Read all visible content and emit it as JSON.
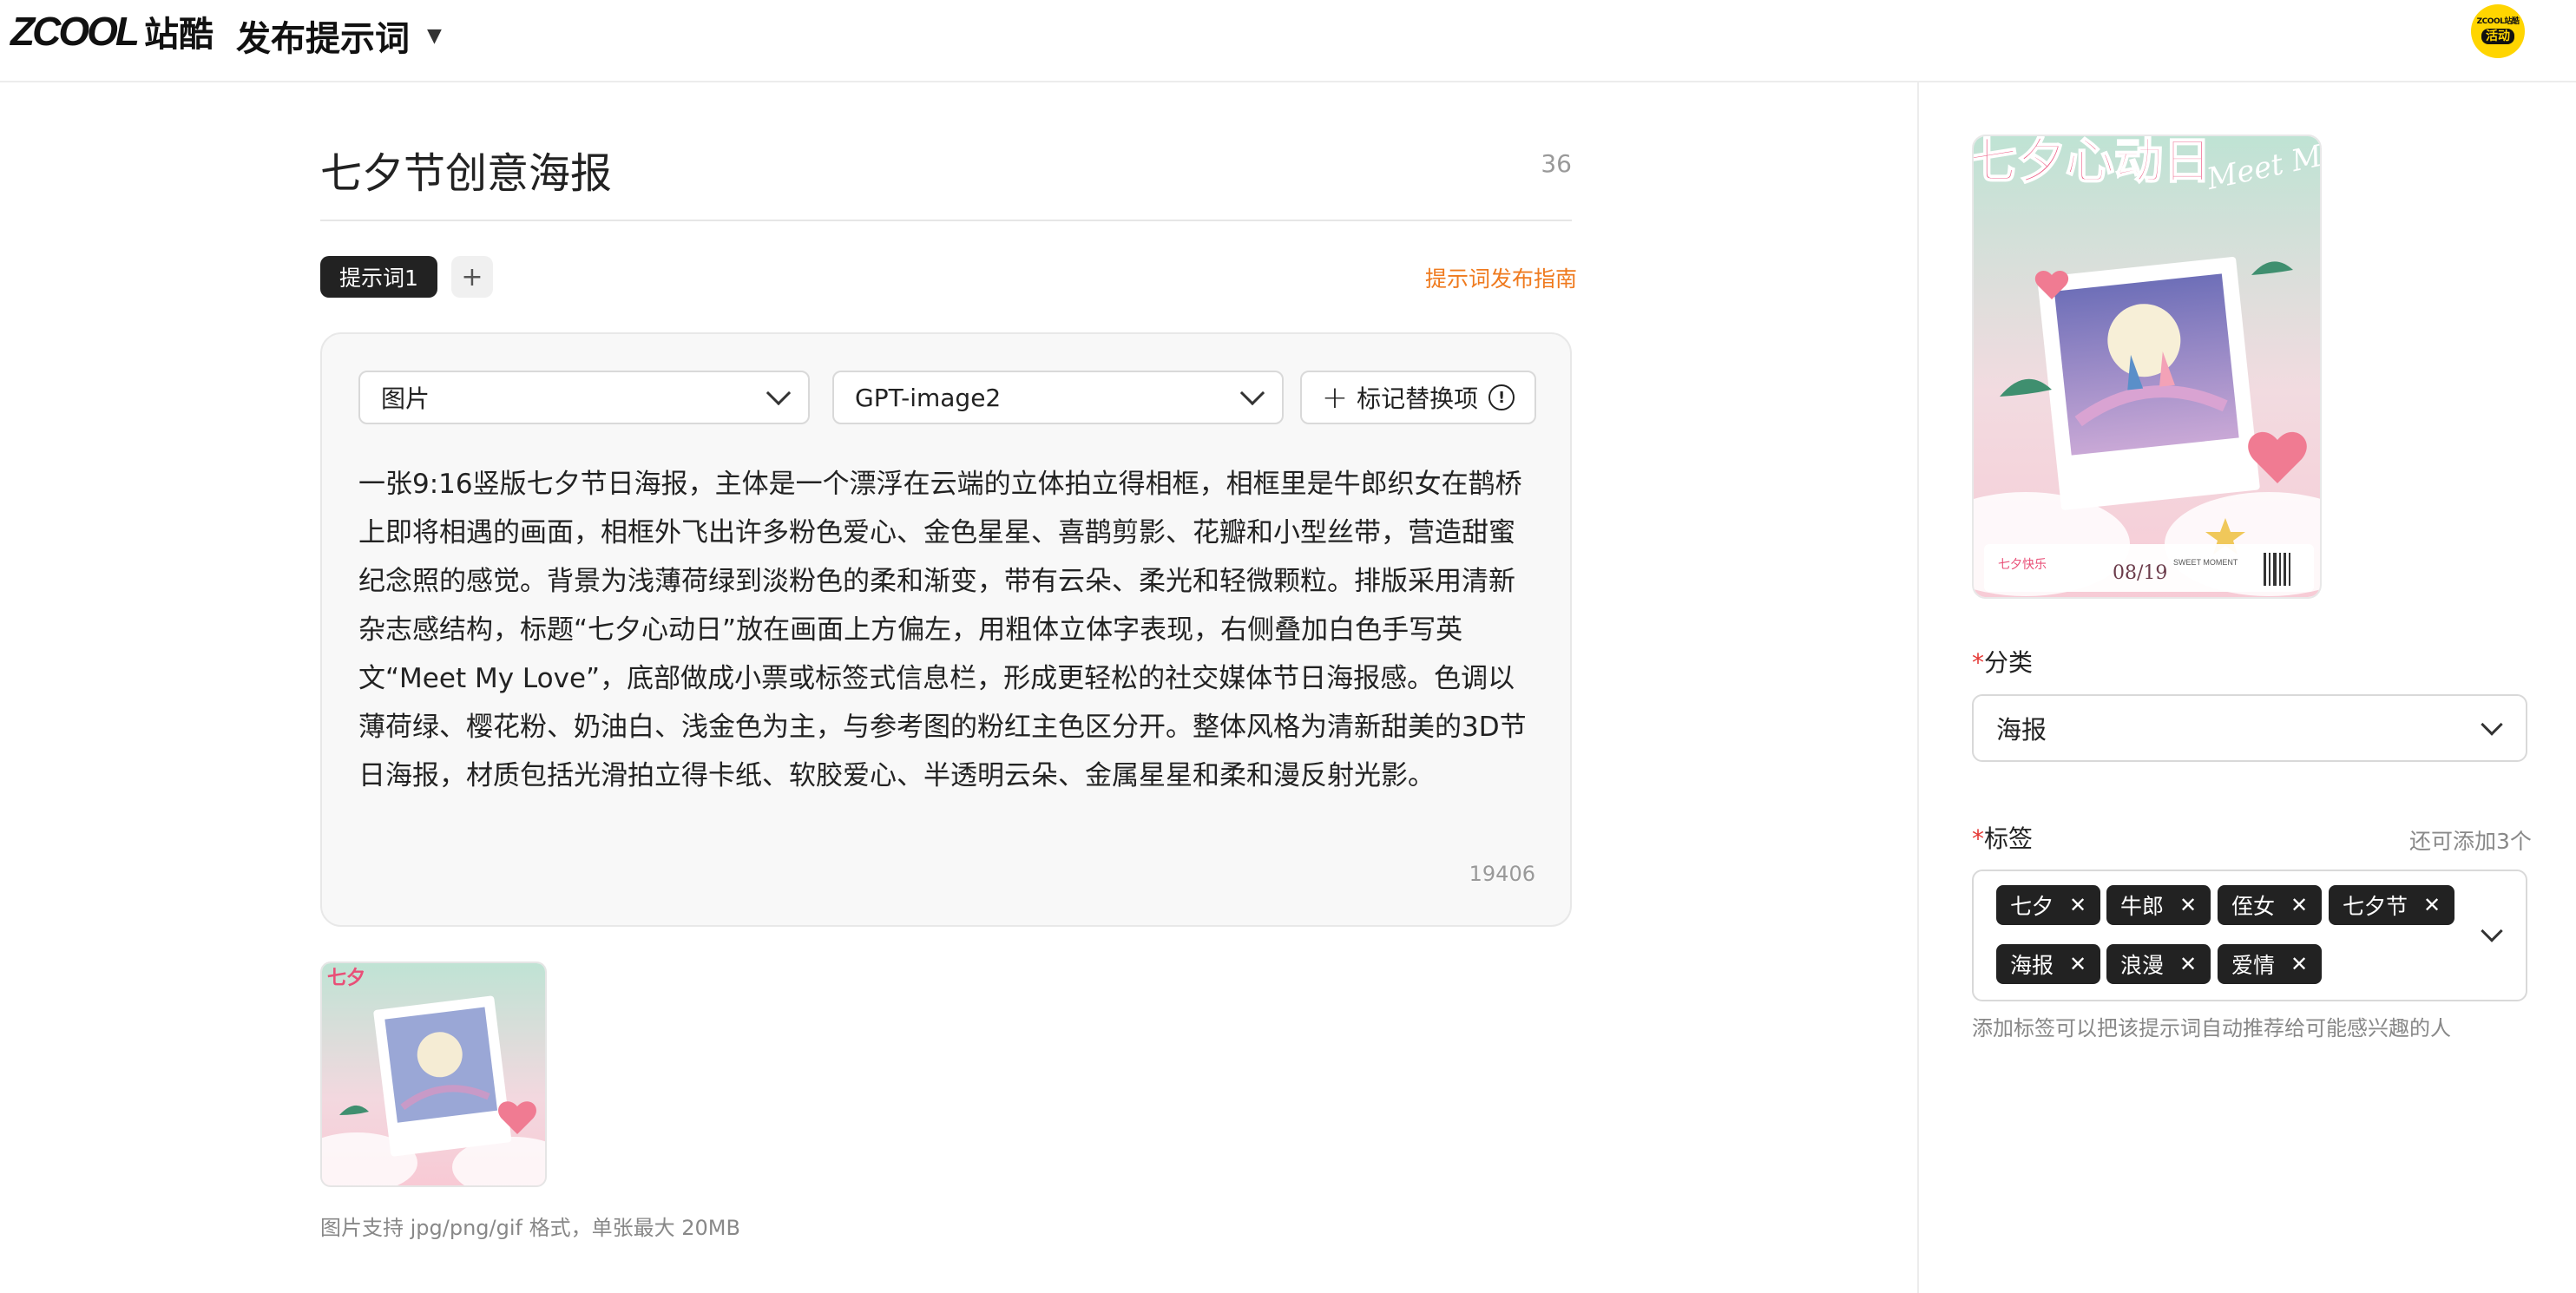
{
  "header": {
    "logo_latin": "ZCOOL",
    "logo_cn": "站酷",
    "page_title": "发布提示词",
    "avatar_top": "ZCOOL站酷",
    "avatar_badge": "活动"
  },
  "title": {
    "value": "七夕节创意海报",
    "count": "36"
  },
  "tabs": {
    "items": [
      "提示词1"
    ],
    "add_label": "+",
    "guide_link": "提示词发布指南"
  },
  "editor": {
    "type_select": "图片",
    "model_select": "GPT-image2",
    "mark_button": "标记替换项",
    "prompt": "一张9:16竖版七夕节日海报，主体是一个漂浮在云端的立体拍立得相框，相框里是牛郎织女在鹊桥上即将相遇的画面，相框外飞出许多粉色爱心、金色星星、喜鹊剪影、花瓣和小型丝带，营造甜蜜纪念照的感觉。背景为浅薄荷绿到淡粉色的柔和渐变，带有云朵、柔光和轻微颗粒。排版采用清新杂志感结构，标题“七夕心动日”放在画面上方偏左，用粗体立体字表现，右侧叠加白色手写英文“Meet My Love”，底部做成小票或标签式信息栏，形成更轻松的社交媒体节日海报感。色调以薄荷绿、樱花粉、奶油白、浅金色为主，与参考图的粉红主色区分开。整体风格为清新甜美的3D节日海报，材质包括光滑拍立得卡纸、软胶爱心、半透明云朵、金属星星和柔和漫反射光影。",
    "count": "19406"
  },
  "upload": {
    "hint": "图片支持 jpg/png/gif 格式，单张最大 20MB"
  },
  "cover": {
    "title_cn": "七夕心动日",
    "title_en": "Meet My Love",
    "ticket_left": "七夕快乐",
    "ticket_date": "08/19",
    "ticket_right": "SWEET MOMENT"
  },
  "category": {
    "required_mark": "*",
    "label": "分类",
    "value": "海报"
  },
  "tags": {
    "required_mark": "*",
    "label": "标签",
    "remaining": "还可添加3个",
    "items": [
      "七夕",
      "牛郎",
      "侄女",
      "七夕节",
      "海报",
      "浪漫",
      "爱情"
    ],
    "hint": "添加标签可以把该提示词自动推荐给可能感兴趣的人"
  },
  "colors": {
    "accent": "#ef7a1e",
    "tag_bg": "#222222",
    "required": "#e53935"
  }
}
